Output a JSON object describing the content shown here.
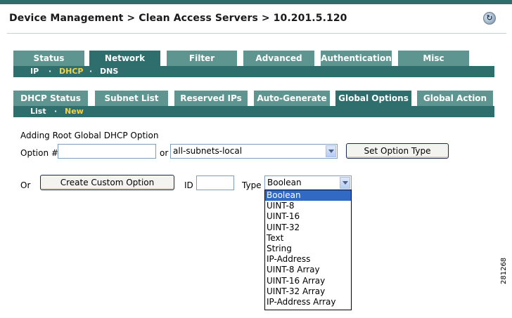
{
  "breadcrumb": "Device Management > Clean Access Servers > 10.201.5.120",
  "help_glyph": "↻",
  "main_tabs": [
    "Status",
    "Network",
    "Filter",
    "Advanced",
    "Authentication",
    "Misc"
  ],
  "main_active": "Network",
  "network_subnav": [
    "IP",
    "DHCP",
    "DNS"
  ],
  "network_subnav_sep": "·",
  "network_subnav_active": "DHCP",
  "dhcp_tabs": [
    "DHCP Status",
    "Subnet List",
    "Reserved IPs",
    "Auto-Generate",
    "Global Options",
    "Global Action"
  ],
  "dhcp_active": "Global Options",
  "options_subnav": [
    "List",
    "New"
  ],
  "options_subnav_sep": "·",
  "options_subnav_active": "New",
  "form": {
    "title": "Adding Root Global DHCP Option",
    "option_label": "Option #",
    "option_value": "",
    "or_label": "or",
    "option_select_value": "all-subnets-local",
    "set_type_button": "Set Option Type",
    "or2_label": "Or",
    "create_custom_button": "Create Custom Option",
    "id_label": "ID",
    "id_value": "",
    "type_label": "Type",
    "type_value": "Boolean",
    "type_options": [
      "Boolean",
      "UINT-8",
      "UINT-16",
      "UINT-32",
      "Text",
      "String",
      "IP-Address",
      "UINT-8 Array",
      "UINT-16 Array",
      "UINT-32 Array",
      "IP-Address Array"
    ]
  },
  "figure_number": "281268",
  "colors": {
    "tab": "#5f9590",
    "tab_active": "#2e6e6c",
    "subnav_active": "#f3d34a",
    "selection": "#316ac5"
  }
}
